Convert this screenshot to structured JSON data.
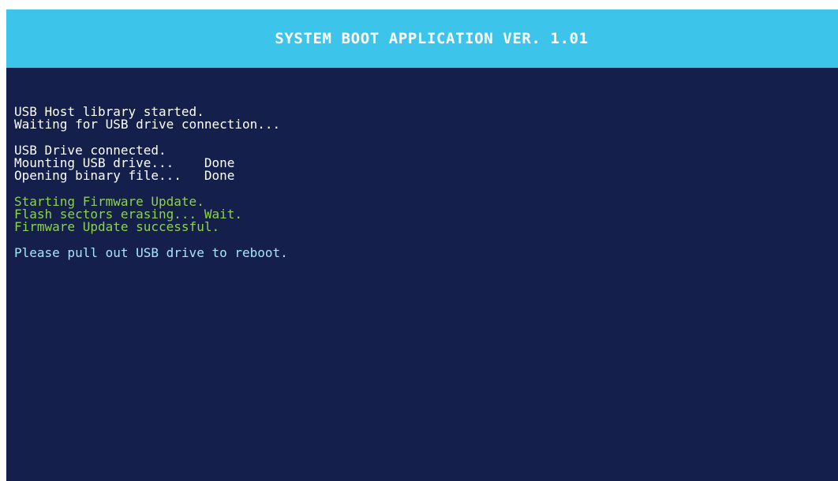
{
  "header": {
    "title": "SYSTEM BOOT APPLICATION VER. 1.01"
  },
  "console": {
    "lines": [
      "USB Host library started.",
      "Waiting for USB drive connection...",
      "USB Drive connected.",
      "Mounting USB drive...    Done",
      "Opening binary file...   Done",
      "Starting Firmware Update.",
      "Flash sectors erasing... Wait.",
      "Firmware Update successful.",
      "Please pull out USB drive to reboot."
    ]
  },
  "colors": {
    "header_bg": "#3dc4ea",
    "screen_bg": "#141f4b",
    "text_white": "#ffffff",
    "text_success": "#8cd24a",
    "text_info": "#a6e6f6"
  }
}
